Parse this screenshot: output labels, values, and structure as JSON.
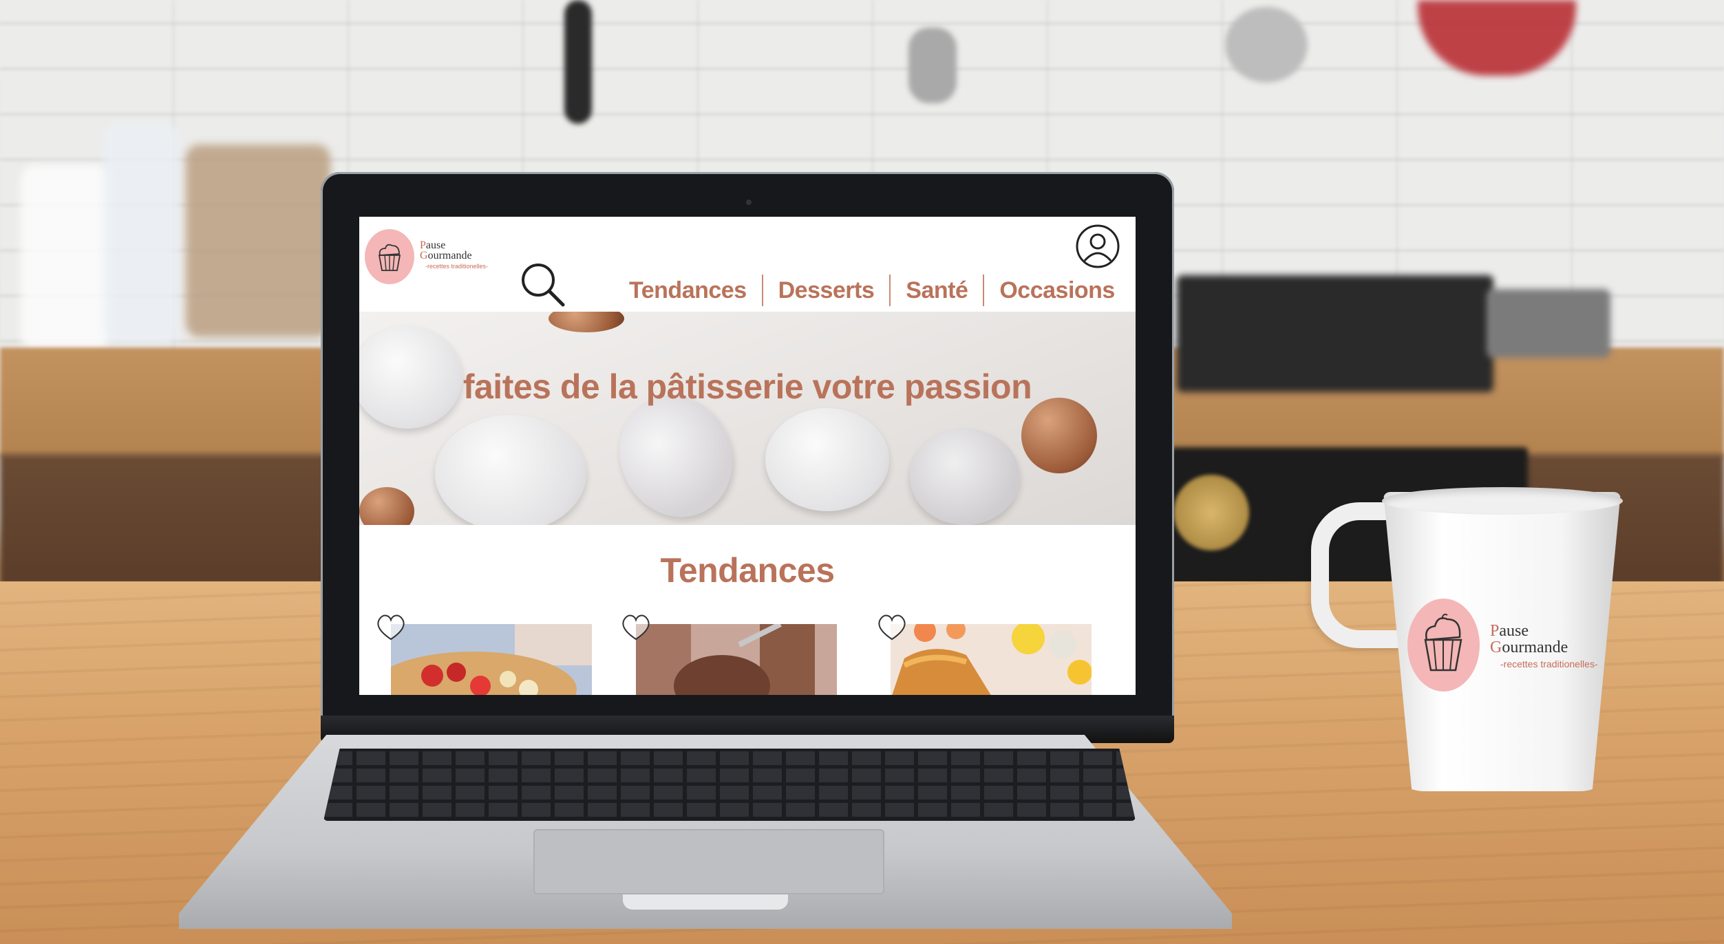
{
  "brand": {
    "line1_cap": "P",
    "line1_rest": "ause",
    "line2_cap": "G",
    "line2_rest": "ourmande",
    "tagline": "-recettes traditionelles-",
    "accent_color": "#b9735a",
    "logo_pink": "#f4b6b6"
  },
  "nav": {
    "items": [
      "Tendances",
      "Desserts",
      "Santé",
      "Occasions"
    ]
  },
  "hero": {
    "title": "faites de la pâtisserie votre passion"
  },
  "trending": {
    "title": "Tendances",
    "cards": [
      {
        "image": "strawberry-pastry-image"
      },
      {
        "image": "chocolate-ice-cream-image"
      },
      {
        "image": "madeleine-cake-image"
      }
    ]
  },
  "mug": {
    "line1_cap": "P",
    "line1_rest": "ause",
    "line2_cap": "G",
    "line2_rest": "ourmande",
    "tagline": "-recettes traditionelles-"
  }
}
